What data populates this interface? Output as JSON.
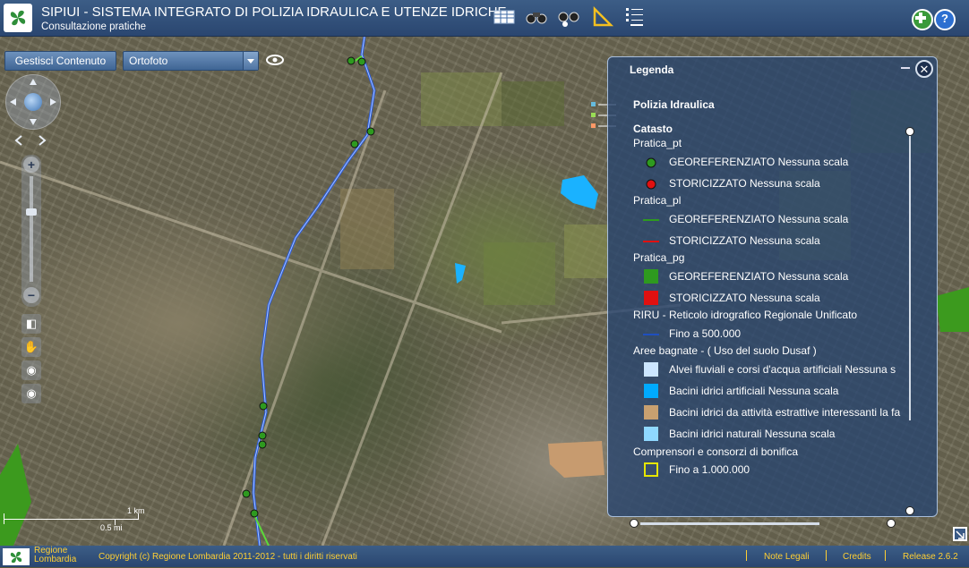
{
  "header": {
    "title": "SIPIUI - SISTEMA INTEGRATO DI POLIZIA IDRAULICA E UTENZE IDRICHE",
    "subtitle": "Consultazione pratiche",
    "tools": [
      "table-icon",
      "binoculars-icon",
      "binoculars-search-icon",
      "ruler-triangle-icon",
      "layer-list-icon"
    ],
    "right_tools": [
      "add-icon",
      "help-icon"
    ]
  },
  "toolbar": {
    "manage_label": "Gestisci Contenuto",
    "basemap_value": "Ortofoto"
  },
  "scale": {
    "km": "1 km",
    "mi": "0.5 mi"
  },
  "legend": {
    "title": "Legenda",
    "group": "Polizia Idraulica",
    "section": "Catasto",
    "pratica_pt": "Pratica_pt",
    "pt_geo": "GEOREFERENZIATO Nessuna scala",
    "pt_stor": "STORICIZZATO Nessuna scala",
    "pratica_pl": "Pratica_pl",
    "pl_geo": "GEOREFERENZIATO Nessuna scala",
    "pl_stor": "STORICIZZATO Nessuna scala",
    "pratica_pg": "Pratica_pg",
    "pg_geo": "GEOREFERENZIATO Nessuna scala",
    "pg_stor": "STORICIZZATO Nessuna scala",
    "riru": "RIRU - Reticolo idrografico Regionale Unificato",
    "riru_item": "Fino a 500.000",
    "aree": "Aree bagnate - ( Uso del suolo Dusaf )",
    "aree_1": "Alvei fluviali e corsi d'acqua artificiali Nessuna s",
    "aree_2": "Bacini idrici artificiali Nessuna scala",
    "aree_3": "Bacini idrici da attività estrattive interessanti la fa",
    "aree_4": "Bacini idrici naturali Nessuna scala",
    "compr": "Comprensori e consorzi di bonifica",
    "compr_item": "Fino a 1.000.000",
    "colors": {
      "green_point": "#2e9a1f",
      "red_point": "#e01010",
      "blue_line": "#1f4fbf",
      "alvei": "#cce6ff",
      "bac_art": "#00aaff",
      "bac_estr": "#c8a070",
      "bac_nat": "#8fd8ff",
      "compr": "#e6e600"
    }
  },
  "footer": {
    "region_line1": "Regione",
    "region_line2": "Lombardia",
    "copyright": "Copyright (c) Regione Lombardia 2011-2012 - tutti i diritti riservati",
    "note_legali": "Note Legali",
    "credits": "Credits",
    "release": "Release 2.6.2"
  }
}
